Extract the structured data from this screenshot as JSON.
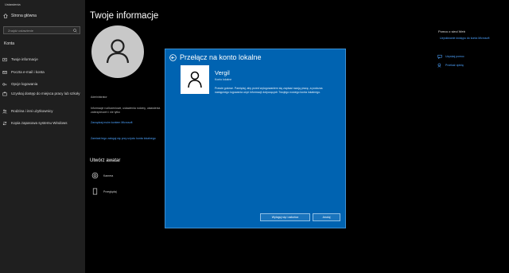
{
  "window": {
    "title": "Ustawienia"
  },
  "sidebar": {
    "home_label": "Strona główna",
    "search_placeholder": "Znajdź ustawienie",
    "section_label": "Konta",
    "items": [
      {
        "icon": "person-card-icon",
        "label": "Twoje informacje"
      },
      {
        "icon": "mail-icon",
        "label": "Poczta e-mail i konta"
      },
      {
        "icon": "key-icon",
        "label": "Opcje logowania"
      },
      {
        "icon": "briefcase-icon",
        "label": "Uzyskaj dostęp do miejsca pracy lub szkoły"
      },
      {
        "icon": "family-icon",
        "label": "Rodzina i inni użytkownicy"
      },
      {
        "icon": "sync-icon",
        "label": "Kopia zapasowa systemu Windows"
      }
    ]
  },
  "main": {
    "title": "Twoje informacje",
    "account_type": "Administrator",
    "info_text": "Informacje rozliczeniowe, ustawienia rodziny, ustawienia zabezpieczeń i nie tylko",
    "link_microsoft": "Zarządzaj moim kontem Microsoft",
    "link_local": "Zamiast tego zaloguj się przy użyciu konta lokalnego",
    "choose_avatar_title": "Utwórz awatar",
    "avatar_options": [
      {
        "icon": "camera-icon",
        "label": "Kamera"
      },
      {
        "icon": "browse-file-icon",
        "label": "Przeglądaj"
      }
    ]
  },
  "right_panel": {
    "heading": "Pomoc z sieci Web",
    "link": "Uzyskiwanie dostępu do konta Microsoft",
    "items": [
      {
        "icon": "help-icon",
        "label": "Uzyskaj pomoc"
      },
      {
        "icon": "feedback-icon",
        "label": "Przekaż opinię"
      }
    ]
  },
  "dialog": {
    "title": "Przełącz na konto lokalne",
    "user_name": "Vergil",
    "user_type": "Konto lokalne",
    "message": "Prawie gotowe. Pamiętaj, aby przed wylogowaniem się zapisać swoją pracę, a podczas następnego logowania użyć informacji dotyczących Twojego nowego konta lokalnego.",
    "primary_button": "Wyloguj się i zakończ",
    "cancel_button": "Anuluj"
  },
  "colors": {
    "dialog_bg": "#0063b1",
    "link": "#4da3ff",
    "sidebar_bg": "#1f1f1f",
    "page_bg": "#000000"
  }
}
